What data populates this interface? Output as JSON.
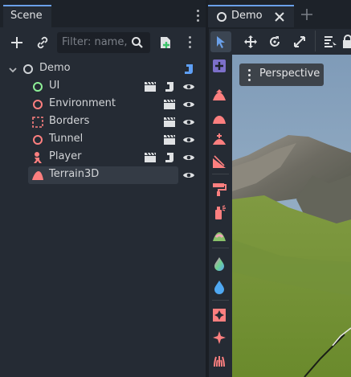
{
  "scene_dock": {
    "tab_label": "Scene",
    "filter_placeholder": "Filter: name,",
    "tree": [
      {
        "label": "Demo",
        "icon": "node3d-icon",
        "icon_color": "#cfd2d6"
      },
      {
        "label": "UI",
        "icon": "control-icon",
        "icon_color": "#8eef97"
      },
      {
        "label": "Environment",
        "icon": "node3d-icon",
        "icon_color": "#fc7f7f"
      },
      {
        "label": "Borders",
        "icon": "bounds-icon",
        "icon_color": "#fc7f7f"
      },
      {
        "label": "Tunnel",
        "icon": "node3d-icon",
        "icon_color": "#fc7f7f"
      },
      {
        "label": "Player",
        "icon": "character-icon",
        "icon_color": "#fc7f7f"
      },
      {
        "label": "Terrain3D",
        "icon": "terrain-icon",
        "icon_color": "#fc7f7f"
      }
    ]
  },
  "viewport": {
    "tab_label": "Demo",
    "perspective_label": "Perspective"
  },
  "colors": {
    "accent": "#6aa0e9",
    "node3d": "#fc7f7f",
    "control": "#8eef97",
    "script": "#5e9ff5"
  }
}
